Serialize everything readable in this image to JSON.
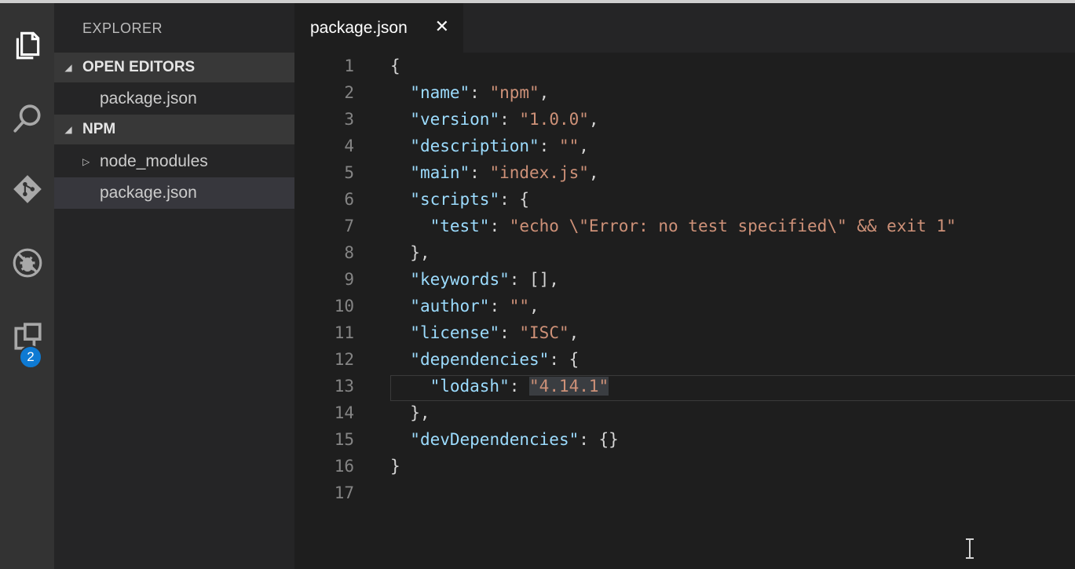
{
  "activity_bar": {
    "items": [
      {
        "icon": "files-icon"
      },
      {
        "icon": "search-icon"
      },
      {
        "icon": "git-icon"
      },
      {
        "icon": "debug-icon"
      },
      {
        "icon": "extensions-icon",
        "badge": "2"
      }
    ]
  },
  "sidebar": {
    "title": "EXPLORER",
    "open_editors": {
      "label": "OPEN EDITORS",
      "items": [
        "package.json"
      ]
    },
    "project": {
      "label": "NPM",
      "items": [
        "node_modules",
        "package.json"
      ]
    }
  },
  "tab": {
    "label": "package.json",
    "close": "✕"
  },
  "editor": {
    "line_numbers": [
      "1",
      "2",
      "3",
      "4",
      "5",
      "6",
      "7",
      "8",
      "9",
      "10",
      "11",
      "12",
      "13",
      "14",
      "15",
      "16",
      "17"
    ],
    "lines": [
      "{",
      "  \"name\": \"npm\",",
      "  \"version\": \"1.0.0\",",
      "  \"description\": \"\",",
      "  \"main\": \"index.js\",",
      "  \"scripts\": {",
      "    \"test\": \"echo \\\"Error: no test specified\\\" && exit 1\"",
      "  },",
      "  \"keywords\": [],",
      "  \"author\": \"\",",
      "  \"license\": \"ISC\",",
      "  \"dependencies\": {",
      "    \"lodash\": \"4.14.1\"",
      "  },",
      "  \"devDependencies\": {}",
      "}",
      ""
    ],
    "highlighted_value": "\"4.14.1\""
  },
  "colors": {
    "key": "#9cdcfe",
    "string": "#ce9178",
    "punct": "#d4d4d4",
    "badge": "#0e7ad3"
  }
}
